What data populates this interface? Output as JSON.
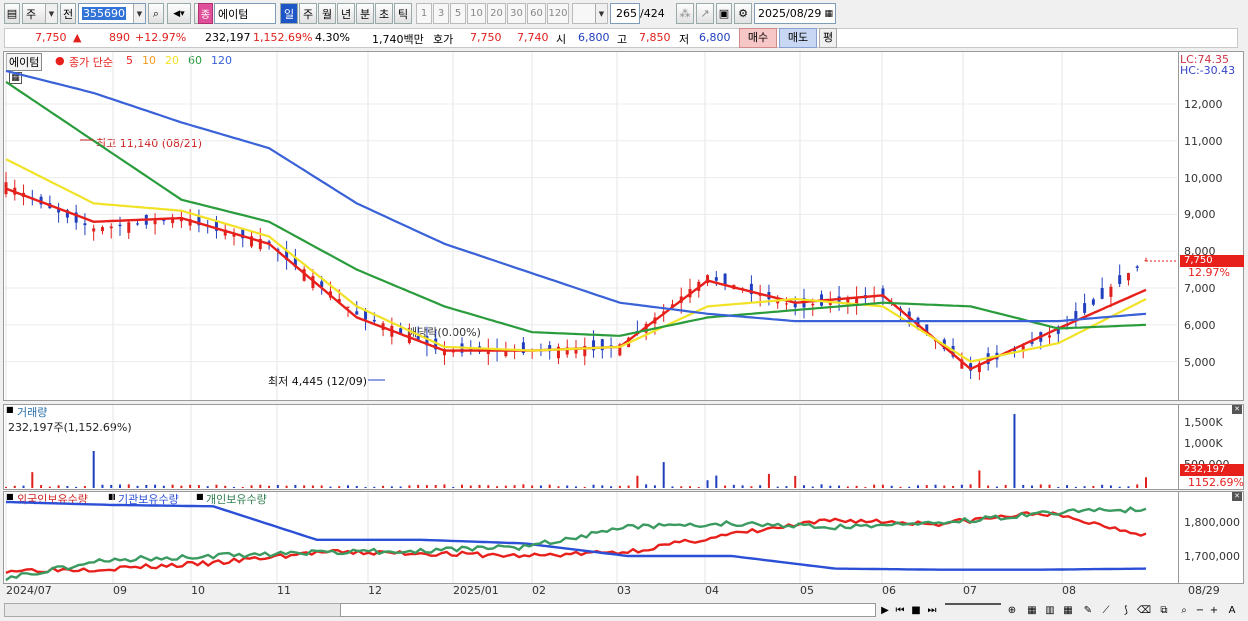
{
  "toolbar": {
    "market": "주",
    "period_mode": "전",
    "code": "355690",
    "name": "에이텀",
    "intervals": [
      "일",
      "주",
      "월",
      "년",
      "분",
      "초",
      "틱"
    ],
    "active_interval": "일",
    "nums": [
      "1",
      "3",
      "5",
      "10",
      "20",
      "30",
      "60",
      "120"
    ],
    "count": "265",
    "total": "/424",
    "date": "2025/08/29"
  },
  "info": {
    "price": "7,750",
    "arrow": "▲",
    "change": "890",
    "pct": "+12.97%",
    "volume": "232,197",
    "vol_ratio": "1,152.69%",
    "turnover_rate": "4.30%",
    "amount": "1,740백만",
    "quote_label": "호가",
    "ask": "7,750",
    "bid": "7,740",
    "open_label": "시",
    "open": "6,800",
    "high_label": "고",
    "high": "7,850",
    "low_label": "저",
    "low": "6,800",
    "buy": "매수",
    "sell": "매도",
    "avg": "평"
  },
  "price_panel": {
    "legend_name": "에이텀",
    "legend_title": "종가 단순",
    "ma_labels": [
      "5",
      "10",
      "20",
      "60",
      "120"
    ],
    "lc": "LC:74.35",
    "hc": "HC:-30.43",
    "max_note": "최고 11,140 (08/21)",
    "min_note": "최저 4,445 (12/09)",
    "div_note": "배당락(0.00%)",
    "last_price": "7,750",
    "last_pct": "12.97%",
    "yticks": [
      "12,000",
      "11,000",
      "10,000",
      "9,000",
      "8,000",
      "7,000",
      "6,000",
      "5,000"
    ]
  },
  "volume_panel": {
    "title": "거래량",
    "value": "232,197주(1,152.69%)",
    "yticks": [
      "1,500K",
      "1,000K",
      "500,000"
    ],
    "last": "232,197",
    "last_pct": "1152.69%"
  },
  "holding_panel": {
    "legends": [
      "외국인보유수량",
      "기관보유수량",
      "개인보유수량"
    ],
    "yticks": [
      "1,800,000",
      "1,700,000"
    ]
  },
  "xaxis": {
    "labels": [
      "2024/07",
      "09",
      "10",
      "11",
      "12",
      "2025/01",
      "02",
      "03",
      "04",
      "05",
      "06",
      "07",
      "08"
    ],
    "end": "08/29"
  },
  "colors": {
    "up": "#e0201c",
    "down": "#1f3fbf",
    "ma5": "#e8201c",
    "ma10": "#f39a1e",
    "ma20": "#f2e225",
    "ma60": "#2a9c3c",
    "ma120": "#3a62d8",
    "foreign": "#e8201c",
    "inst": "#2b4fd6",
    "retail": "#3a9a60"
  },
  "chart_data": [
    {
      "type": "candlestick",
      "title": "에이텀 종가 단순",
      "ylim": [
        4000,
        13000
      ],
      "x": [
        "2024/07",
        "2024/08",
        "2024/09",
        "2024/10",
        "2024/11",
        "2024/12",
        "2025/01",
        "2025/02",
        "2025/03",
        "2025/04",
        "2025/05",
        "2025/06",
        "2025/07",
        "2025/08/29"
      ],
      "series": [
        {
          "name": "종가",
          "values": [
            9800,
            8600,
            8900,
            8200,
            6300,
            5300,
            5300,
            5400,
            7300,
            6500,
            6800,
            4800,
            5800,
            7750
          ]
        },
        {
          "name": "5",
          "values": [
            9700,
            8800,
            8900,
            8200,
            6200,
            5300,
            5300,
            5400,
            7200,
            6600,
            6800,
            4800,
            5900,
            6950
          ]
        },
        {
          "name": "20",
          "values": [
            10500,
            9300,
            9100,
            8400,
            6500,
            5400,
            5300,
            5400,
            6500,
            6700,
            6500,
            5000,
            5500,
            6700
          ]
        },
        {
          "name": "60",
          "values": [
            12600,
            11000,
            9400,
            8800,
            7500,
            6500,
            5800,
            5700,
            6200,
            6400,
            6600,
            6500,
            5900,
            6000
          ]
        },
        {
          "name": "120",
          "values": [
            12900,
            12300,
            11500,
            10800,
            9300,
            8200,
            7400,
            6600,
            6300,
            6100,
            6100,
            6100,
            6100,
            6300
          ]
        }
      ]
    },
    {
      "type": "bar",
      "title": "거래량",
      "max_value": 1600000,
      "last_value": 232197
    },
    {
      "type": "line",
      "title": "보유수량",
      "ylim": [
        1640000,
        1860000
      ],
      "x": [
        "2024/07",
        "2024/09",
        "2024/11",
        "2024/12",
        "2025/01",
        "2025/02",
        "2025/03",
        "2025/04",
        "2025/05",
        "2025/06",
        "2025/07",
        "2025/08"
      ],
      "series": [
        {
          "name": "외국인보유수량",
          "values": [
            1660000,
            1665000,
            1680000,
            1710000,
            1708000,
            1700000,
            1712000,
            1760000,
            1800000,
            1790000,
            1820000,
            1760000
          ]
        },
        {
          "name": "기관보유수량",
          "values": [
            1850000,
            1842000,
            1838000,
            1745000,
            1745000,
            1735000,
            1700000,
            1700000,
            1665000,
            1662000,
            1662000,
            1665000
          ]
        },
        {
          "name": "개인보유수량",
          "values": [
            1640000,
            1690000,
            1700000,
            1710000,
            1715000,
            1725000,
            1780000,
            1790000,
            1780000,
            1790000,
            1820000,
            1830000
          ]
        }
      ]
    }
  ]
}
